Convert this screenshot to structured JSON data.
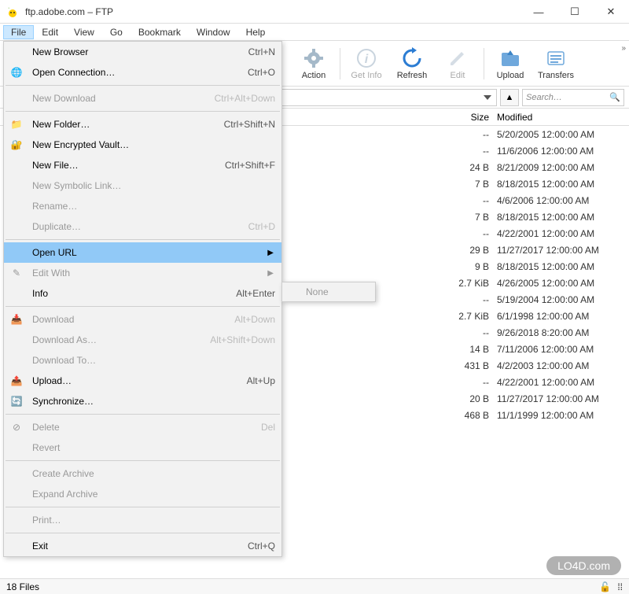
{
  "title": "ftp.adobe.com – FTP",
  "menubar": [
    "File",
    "Edit",
    "View",
    "Go",
    "Bookmark",
    "Window",
    "Help"
  ],
  "toolbar": {
    "action": "Action",
    "get_info": "Get Info",
    "refresh": "Refresh",
    "edit": "Edit",
    "upload": "Upload",
    "transfers": "Transfers"
  },
  "search_placeholder": "Search…",
  "columns": {
    "size": "Size",
    "modified": "Modified"
  },
  "files": [
    {
      "size": "--",
      "modified": "5/20/2005 12:00:00 AM"
    },
    {
      "size": "--",
      "modified": "11/6/2006 12:00:00 AM"
    },
    {
      "size": "24 B",
      "modified": "8/21/2009 12:00:00 AM"
    },
    {
      "size": "7 B",
      "modified": "8/18/2015 12:00:00 AM"
    },
    {
      "size": "--",
      "modified": "4/6/2006 12:00:00 AM"
    },
    {
      "size": "7 B",
      "modified": "8/18/2015 12:00:00 AM"
    },
    {
      "size": "--",
      "modified": "4/22/2001 12:00:00 AM"
    },
    {
      "size": "29 B",
      "modified": "11/27/2017 12:00:00 AM"
    },
    {
      "size": "9 B",
      "modified": "8/18/2015 12:00:00 AM"
    },
    {
      "size": "2.7 KiB",
      "modified": "4/26/2005 12:00:00 AM"
    },
    {
      "size": "--",
      "modified": "5/19/2004 12:00:00 AM"
    },
    {
      "size": "2.7 KiB",
      "modified": "6/1/1998 12:00:00 AM"
    },
    {
      "size": "--",
      "modified": "9/26/2018 8:20:00 AM"
    },
    {
      "size": "14 B",
      "modified": "7/11/2006 12:00:00 AM"
    },
    {
      "size": "431 B",
      "modified": "4/2/2003 12:00:00 AM"
    },
    {
      "size": "--",
      "modified": "4/22/2001 12:00:00 AM"
    },
    {
      "size": "20 B",
      "modified": "11/27/2017 12:00:00 AM"
    },
    {
      "size": "468 B",
      "modified": "11/1/1999 12:00:00 AM"
    }
  ],
  "status": "18 Files",
  "file_menu": [
    {
      "type": "item",
      "icon": "",
      "label": "New Browser",
      "shortcut": "Ctrl+N",
      "enabled": true
    },
    {
      "type": "item",
      "icon": "globe",
      "label": "Open Connection…",
      "shortcut": "Ctrl+O",
      "enabled": true
    },
    {
      "type": "sep"
    },
    {
      "type": "item",
      "icon": "",
      "label": "New Download",
      "shortcut": "Ctrl+Alt+Down",
      "enabled": false
    },
    {
      "type": "sep"
    },
    {
      "type": "item",
      "icon": "folder-plus",
      "label": "New Folder…",
      "shortcut": "Ctrl+Shift+N",
      "enabled": true
    },
    {
      "type": "item",
      "icon": "vault",
      "label": "New Encrypted Vault…",
      "shortcut": "",
      "enabled": true
    },
    {
      "type": "item",
      "icon": "",
      "label": "New File…",
      "shortcut": "Ctrl+Shift+F",
      "enabled": true
    },
    {
      "type": "item",
      "icon": "",
      "label": "New Symbolic Link…",
      "shortcut": "",
      "enabled": false
    },
    {
      "type": "item",
      "icon": "",
      "label": "Rename…",
      "shortcut": "",
      "enabled": false
    },
    {
      "type": "item",
      "icon": "",
      "label": "Duplicate…",
      "shortcut": "Ctrl+D",
      "enabled": false
    },
    {
      "type": "sep"
    },
    {
      "type": "item",
      "icon": "",
      "label": "Open URL",
      "shortcut": "",
      "enabled": true,
      "submenu": true,
      "highlighted": true
    },
    {
      "type": "item",
      "icon": "pencil",
      "label": "Edit With",
      "shortcut": "",
      "enabled": false,
      "submenu": true
    },
    {
      "type": "item",
      "icon": "",
      "label": "Info",
      "shortcut": "Alt+Enter",
      "enabled": true
    },
    {
      "type": "sep"
    },
    {
      "type": "item",
      "icon": "download",
      "label": "Download",
      "shortcut": "Alt+Down",
      "enabled": false
    },
    {
      "type": "item",
      "icon": "",
      "label": "Download As…",
      "shortcut": "Alt+Shift+Down",
      "enabled": false
    },
    {
      "type": "item",
      "icon": "",
      "label": "Download To…",
      "shortcut": "",
      "enabled": false
    },
    {
      "type": "item",
      "icon": "upload",
      "label": "Upload…",
      "shortcut": "Alt+Up",
      "enabled": true
    },
    {
      "type": "item",
      "icon": "sync",
      "label": "Synchronize…",
      "shortcut": "",
      "enabled": true
    },
    {
      "type": "sep"
    },
    {
      "type": "item",
      "icon": "trash",
      "label": "Delete",
      "shortcut": "Del",
      "enabled": false
    },
    {
      "type": "item",
      "icon": "",
      "label": "Revert",
      "shortcut": "",
      "enabled": false
    },
    {
      "type": "sep"
    },
    {
      "type": "item",
      "icon": "",
      "label": "Create Archive",
      "shortcut": "",
      "enabled": false
    },
    {
      "type": "item",
      "icon": "",
      "label": "Expand Archive",
      "shortcut": "",
      "enabled": false
    },
    {
      "type": "sep"
    },
    {
      "type": "item",
      "icon": "",
      "label": "Print…",
      "shortcut": "",
      "enabled": false
    },
    {
      "type": "sep"
    },
    {
      "type": "item",
      "icon": "",
      "label": "Exit",
      "shortcut": "Ctrl+Q",
      "enabled": true
    }
  ],
  "submenu_label": "None",
  "watermark": "LO4D.com"
}
